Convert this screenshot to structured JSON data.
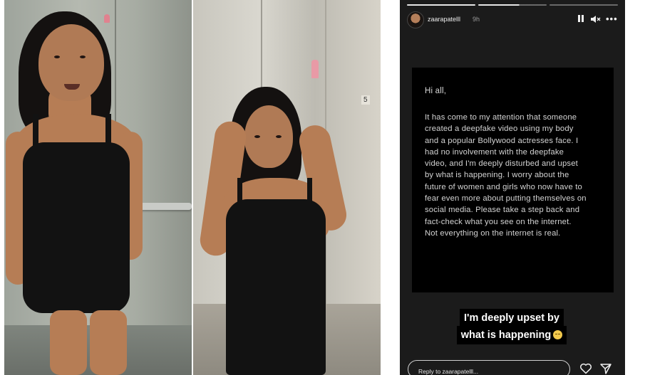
{
  "story": {
    "username": "zaarapatelll",
    "time": "9h",
    "controls": {
      "pause_icon": "pause-icon",
      "mute_icon": "speaker-muted-icon",
      "more_icon": "more-horizontal-icon"
    },
    "note": {
      "greeting": "Hi all,",
      "body": "It has come to my attention that someone\ncreated a deepfake video using my body\nand a popular Bollywood actresses face. I\nhad no involvement with the deepfake\nvideo, and I'm deeply disturbed and upset\nby what is happening. I worry about the\nfuture of women and girls who now have to\nfear even more about putting themselves on\nsocial media. Please take a step back and\nfact-check what you see on the internet.\nNot everything on the internet is real."
    },
    "caption": {
      "line1": "I'm deeply upset by",
      "line2": "what is happening"
    },
    "reply_placeholder": "Reply to zaarapatelll...",
    "icons": {
      "like": "heart-icon",
      "send": "send-icon"
    }
  },
  "photos": {
    "left_sign": "elevator-heart-icon",
    "right_floor_number": "5"
  }
}
